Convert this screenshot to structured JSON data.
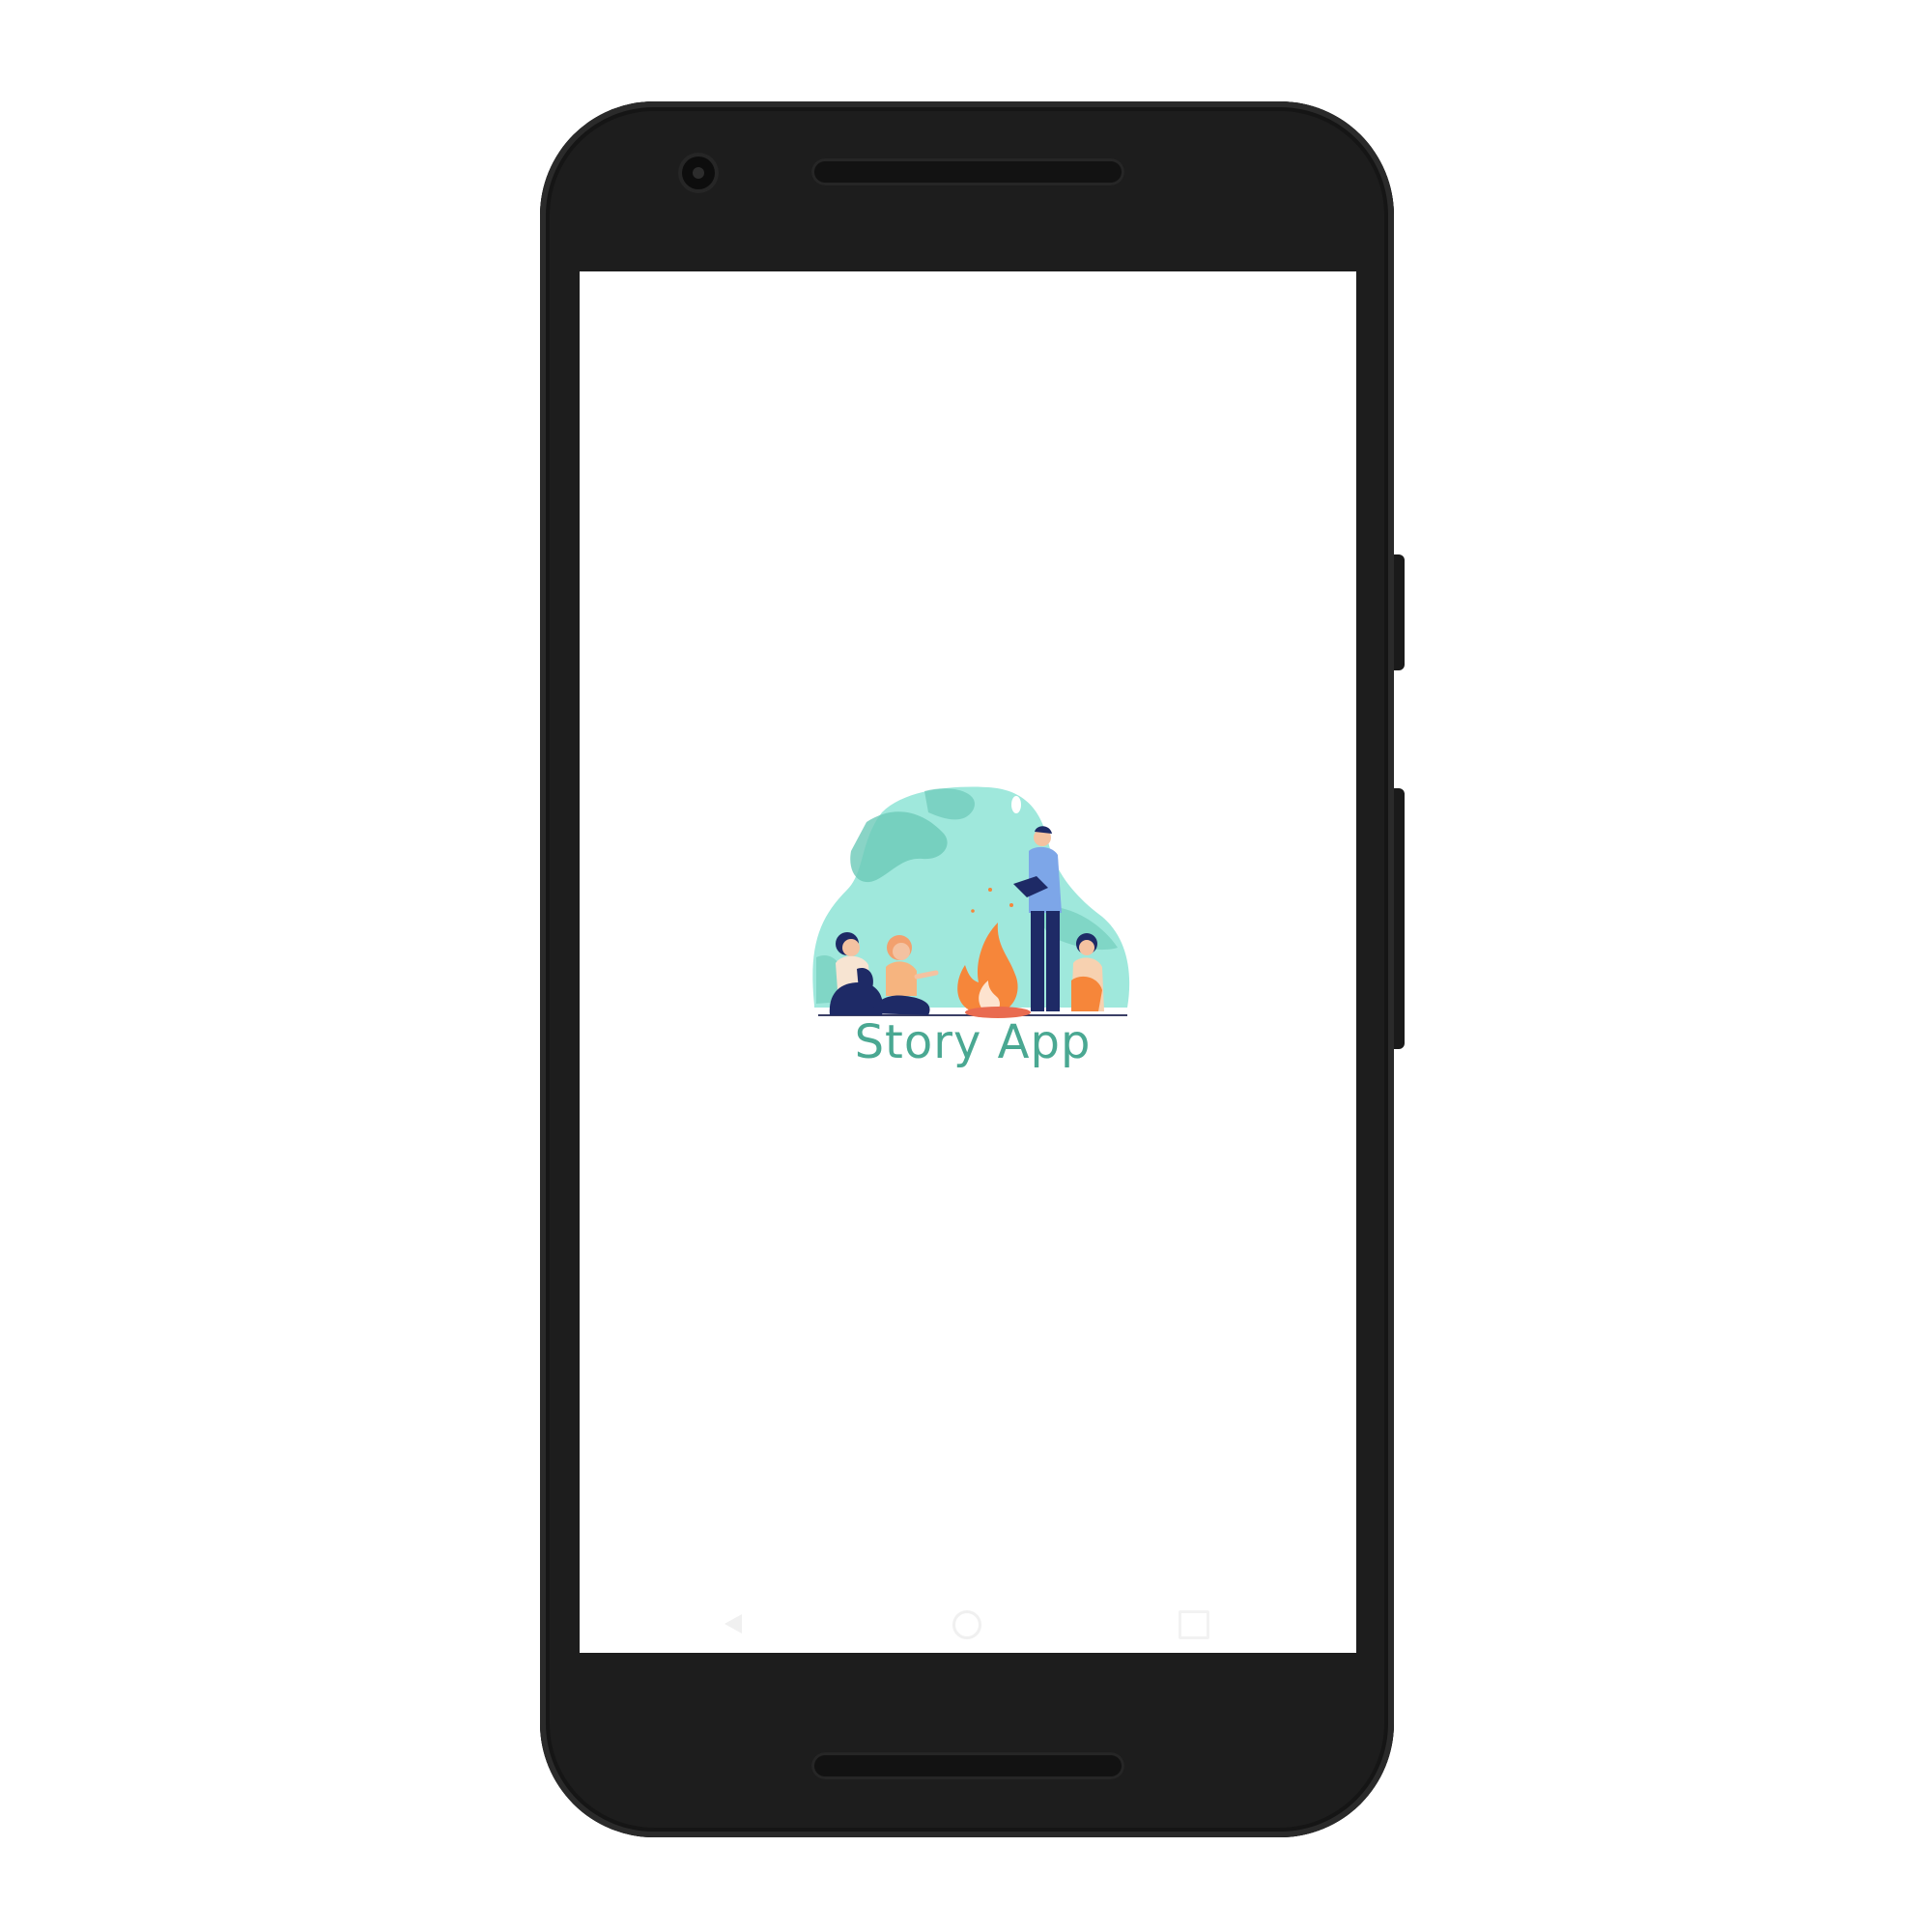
{
  "app": {
    "title": "Story App"
  },
  "splash": {
    "illustration_icon": "campfire-storytelling-illustration"
  },
  "navbar": {
    "back_icon": "back-triangle-icon",
    "home_icon": "home-circle-icon",
    "recents_icon": "recents-square-icon"
  },
  "colors": {
    "brand_teal": "#4aa892",
    "blob_light": "#9fe8dc",
    "blob_dark": "#6cc9b8",
    "fire_orange": "#f6863a",
    "navy": "#1e2a66",
    "device_body": "#1d1d1d",
    "screen_bg": "#ffffff"
  }
}
